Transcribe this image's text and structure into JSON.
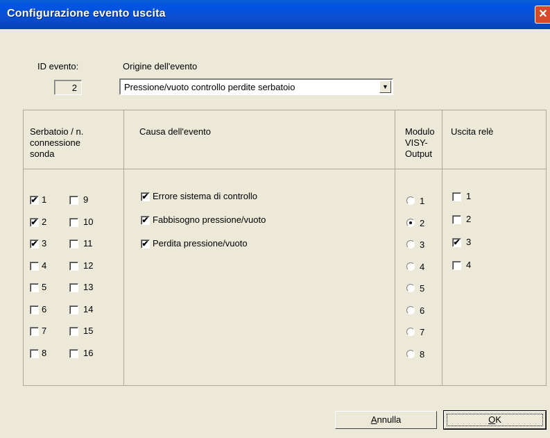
{
  "window": {
    "title": "Configurazione evento uscita",
    "close_glyph": "✕"
  },
  "id_event": {
    "label": "ID evento:",
    "value": "2"
  },
  "origin": {
    "label": "Origine dell'evento",
    "selected": "Pressione/vuoto controllo perdite serbatoio"
  },
  "headers": {
    "tank_line1": "Serbatoio / n.",
    "tank_line2": "connessione",
    "tank_line3": "sonda",
    "cause": "Causa dell'evento",
    "module_line1": "Modulo",
    "module_line2": "VISY-",
    "module_line3": "Output",
    "relay": "Uscita relè"
  },
  "tanks": [
    {
      "label": "1",
      "checked": true
    },
    {
      "label": "2",
      "checked": true
    },
    {
      "label": "3",
      "checked": true
    },
    {
      "label": "4",
      "checked": false
    },
    {
      "label": "5",
      "checked": false
    },
    {
      "label": "6",
      "checked": false
    },
    {
      "label": "7",
      "checked": false
    },
    {
      "label": "8",
      "checked": false
    },
    {
      "label": "9",
      "checked": false
    },
    {
      "label": "10",
      "checked": false
    },
    {
      "label": "11",
      "checked": false
    },
    {
      "label": "12",
      "checked": false
    },
    {
      "label": "13",
      "checked": false
    },
    {
      "label": "14",
      "checked": false
    },
    {
      "label": "15",
      "checked": false
    },
    {
      "label": "16",
      "checked": false
    }
  ],
  "causes": [
    {
      "label": "Errore sistema di controllo",
      "checked": true
    },
    {
      "label": "Fabbisogno pressione/vuoto",
      "checked": true
    },
    {
      "label": "Perdita pressione/vuoto",
      "checked": true
    }
  ],
  "modules": [
    {
      "label": "1",
      "selected": false
    },
    {
      "label": "2",
      "selected": true
    },
    {
      "label": "3",
      "selected": false
    },
    {
      "label": "4",
      "selected": false
    },
    {
      "label": "5",
      "selected": false
    },
    {
      "label": "6",
      "selected": false
    },
    {
      "label": "7",
      "selected": false
    },
    {
      "label": "8",
      "selected": false
    }
  ],
  "relays": [
    {
      "label": "1",
      "checked": false
    },
    {
      "label": "2",
      "checked": false
    },
    {
      "label": "3",
      "checked": true
    },
    {
      "label": "4",
      "checked": false
    }
  ],
  "buttons": {
    "cancel_first": "A",
    "cancel_rest": "nnulla",
    "ok_first": "O",
    "ok_rest": "K"
  },
  "check_glyph": "✔",
  "dropdown_glyph": "▼"
}
